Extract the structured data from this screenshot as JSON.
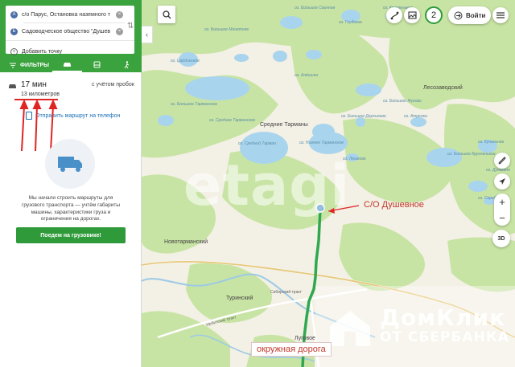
{
  "route_panel": {
    "point_a_badge": "A",
    "point_a": "с/о Парус, Остановка наземного т",
    "point_b_badge": "Б",
    "point_b": "Садоводческое общество \"Душев",
    "add_point": "Добавить точку",
    "tabs": {
      "filters": "ФИЛЬТРЫ"
    },
    "route_time": "17 мин",
    "route_traffic": "с учётом пробок",
    "route_distance": "13 километров",
    "send_to_phone": "Отправить маршрут на телефон",
    "truck_info": "Мы начали строить маршруты для грузового транспорта — учтём габариты машины, характеристики груза и ограничения на дорогах.",
    "truck_button": "Поедем на грузовике!"
  },
  "map_controls": {
    "notification_count": "2",
    "login_label": "Войти",
    "zoom_in": "+",
    "zoom_out": "−",
    "view_3d": "3D"
  },
  "map_labels": {
    "lesozavodsky": "Лесозаводский",
    "srednie_tarmany": "Средние Тарманы",
    "novotarmansky": "Новотарманский",
    "turinsky": "Туринский",
    "lugovoe": "Луговое",
    "sibirsky_trakt": "Сибирский тракт",
    "irbitsky_trakt": "Ирбитский тракт",
    "lake_bolshoe_tarmanskoe": "оз. Большое Тарманское",
    "lake_srednee_tarmanskoe": "оз. Среднее Тарманское",
    "lake_nizhnee_tarmanskoe": "оз. Нижнее Тарманское",
    "lake_sredny_tarman": "оз. Средний Тарман",
    "lake_tsaidinskoe": "оз. Цайдинское",
    "lake_bolshoe_monetnoe": "оз. Большое Монетное",
    "lake_bolshoe_svinnoe": "оз. Большое Свинное",
    "lake_glubokoe": "оз. Глубокое",
    "lake_kruglenkoe": "оз. Кругленькое",
    "lake_bolshoe_kruglenkoe": "оз. Большое Кругленькое",
    "lake_bolshoe_dergilevo": "оз. Большое Дергилево",
    "lake_leshkovo": "оз. Лешково",
    "lake_atrenka": "оз. Атренка",
    "lake_alyoshino": "оз. Алёшино",
    "lake_bolshoe_zhukovo": "оз. Большое Жуково",
    "lake_kupalnoe": "оз. Купальное",
    "lake_dunkino": "оз. Дунькино",
    "lake_serebro": "оз. Серебро"
  },
  "annotations": {
    "snt_label": "С/О Душевное",
    "ring_road": "окружная дорога"
  },
  "watermarks": {
    "etagi": "etagi",
    "domclick_line1": "ДомКлик",
    "domclick_line2": "ОТ СБЕРБАНКА"
  },
  "colors": {
    "brand_green": "#3aa33d",
    "route_green": "#2fa84f",
    "annotation_red": "#e02424",
    "forest": "#c7e3a2",
    "water": "#a8d3ee"
  }
}
